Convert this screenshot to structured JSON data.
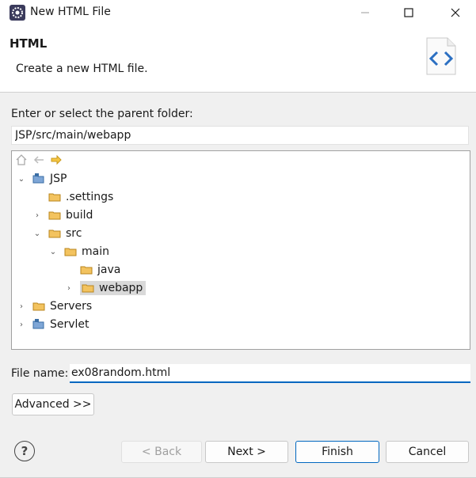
{
  "window": {
    "title": "New HTML File",
    "controls": [
      "minimize-icon",
      "maximize-icon",
      "close-icon"
    ]
  },
  "header": {
    "title": "HTML",
    "description": "Create a new HTML file.",
    "banner_icon": "html-file-icon"
  },
  "folder": {
    "label": "Enter or select the parent folder:",
    "value": "JSP/src/main/webapp"
  },
  "tree": {
    "toolbar_icons": [
      "home-icon",
      "back-arrow-icon",
      "forward-arrow-icon"
    ],
    "items": [
      {
        "label": "JSP",
        "type": "project",
        "expanded": true,
        "depth": 0
      },
      {
        "label": ".settings",
        "type": "folder",
        "depth": 1
      },
      {
        "label": "build",
        "type": "folder",
        "collapsed": true,
        "depth": 1
      },
      {
        "label": "src",
        "type": "folder",
        "expanded": true,
        "depth": 1
      },
      {
        "label": "main",
        "type": "folder",
        "expanded": true,
        "depth": 2
      },
      {
        "label": "java",
        "type": "folder",
        "depth": 3
      },
      {
        "label": "webapp",
        "type": "folder",
        "collapsed": true,
        "selected": true,
        "depth": 3
      },
      {
        "label": "Servers",
        "type": "folder",
        "collapsed": true,
        "depth": 0
      },
      {
        "label": "Servlet",
        "type": "project",
        "collapsed": true,
        "depth": 0
      }
    ]
  },
  "file": {
    "label": "File name:",
    "value": "ex08random.html"
  },
  "buttons": {
    "advanced": "Advanced >>",
    "back": "< Back",
    "next": "Next >",
    "finish": "Finish",
    "cancel": "Cancel",
    "help": "?"
  },
  "colors": {
    "accent": "#0067c0",
    "folder": "#e8b04a"
  }
}
